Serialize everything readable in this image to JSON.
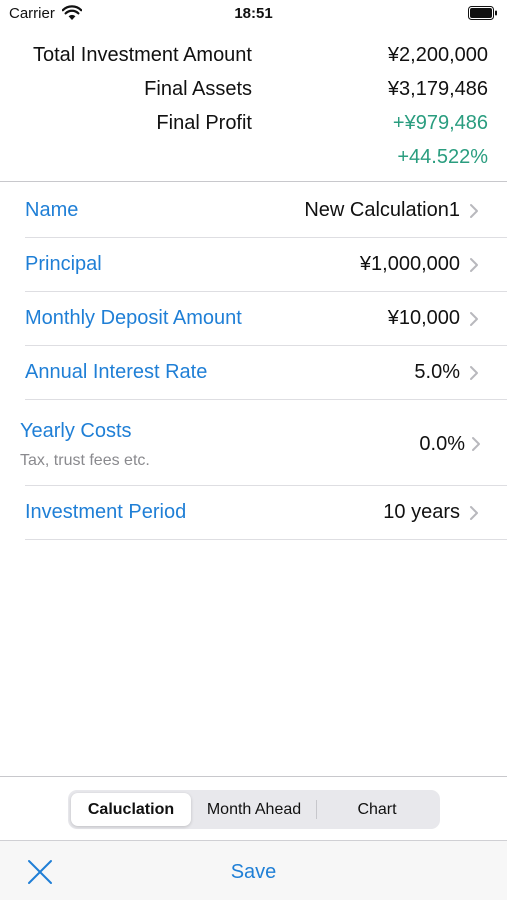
{
  "status_bar": {
    "carrier": "Carrier",
    "time": "18:51",
    "icons": [
      "wifi-icon",
      "battery-icon"
    ]
  },
  "summary": {
    "total_investment_label": "Total Investment Amount",
    "total_investment_value": "¥2,200,000",
    "final_assets_label": "Final Assets",
    "final_assets_value": "¥3,179,486",
    "final_profit_label": "Final Profit",
    "final_profit_value": "+¥979,486",
    "final_profit_percent": "+44.522%",
    "profit_color": "#2a9d7f"
  },
  "settings": {
    "name_label": "Name",
    "name_value": "New Calculation1",
    "principal_label": "Principal",
    "principal_value": "¥1,000,000",
    "monthly_deposit_label": "Monthly Deposit Amount",
    "monthly_deposit_value": "¥10,000",
    "annual_rate_label": "Annual Interest Rate",
    "annual_rate_value": "5.0%",
    "yearly_costs_label": "Yearly Costs",
    "yearly_costs_sublabel": "Tax, trust fees etc.",
    "yearly_costs_value": "0.0%",
    "period_label": "Investment Period",
    "period_value": "10 years",
    "label_color": "#1f7fd6"
  },
  "segmented": {
    "tabs": [
      "Caluclation",
      "Month Ahead",
      "Chart"
    ],
    "selected": "Caluclation"
  },
  "toolbar": {
    "close_icon": "close-icon",
    "save_label": "Save"
  }
}
